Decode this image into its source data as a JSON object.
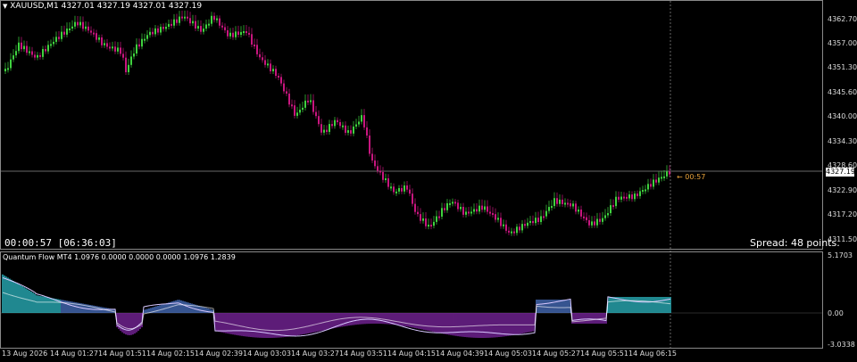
{
  "symbol_header": "XAUUSD,M1  4327.01 4327.19 4327.01 4327.19",
  "indicator_header": "Quantum Flow MT4 1.0976 0.0000 0.0000 0.0000 1.0976 1.2839",
  "timer_text": "00:00:57 [06:36:03]",
  "spread_text": "Spread: 48 points.",
  "countdown_text": "← 00:57",
  "current_price": "4327.19",
  "price_axis": [
    "4362.70",
    "4357.00",
    "4351.30",
    "4345.60",
    "4340.00",
    "4334.30",
    "4328.60",
    "4322.90",
    "4317.20",
    "4311.50"
  ],
  "indicator_axis": [
    "5.1703",
    "0.00",
    "-3.0338"
  ],
  "time_axis": [
    "13 Aug 2026",
    "14 Aug 01:27",
    "14 Aug 01:51",
    "14 Aug 02:15",
    "14 Aug 02:39",
    "14 Aug 03:03",
    "14 Aug 03:27",
    "14 Aug 03:51",
    "14 Aug 04:15",
    "14 Aug 04:39",
    "14 Aug 05:03",
    "14 Aug 05:27",
    "14 Aug 05:51",
    "14 Aug 06:15"
  ],
  "colors": {
    "bull": "#3fd23f",
    "bear": "#c8167f",
    "hist_pos": "#5b8cf0",
    "hist_pos_strong": "#35e3f0",
    "hist_neg": "#9b2fc9",
    "hist_neg_light": "#f0a6e6",
    "signal_line": "#d8c8ff",
    "panel_border": "#8a8a8a",
    "countdown": "#e8a23a"
  },
  "icons": [
    "dropdown-triangle-icon"
  ]
}
